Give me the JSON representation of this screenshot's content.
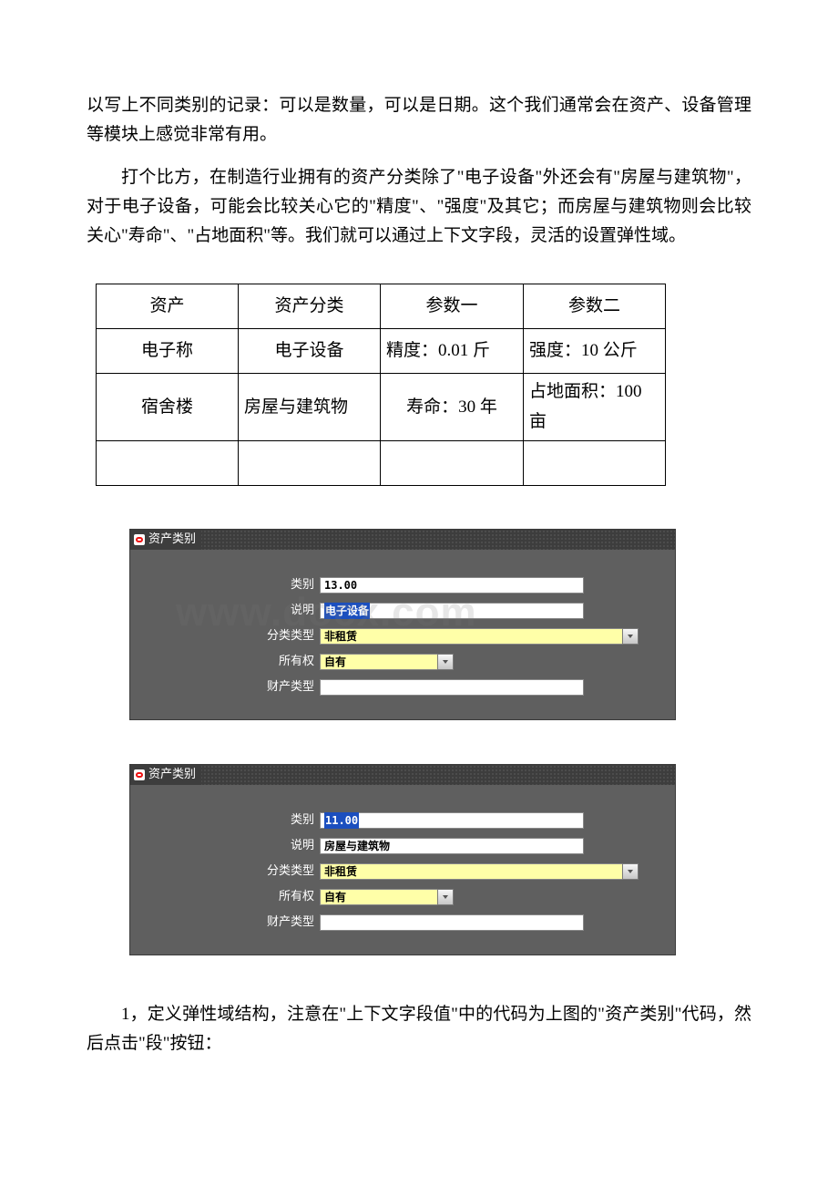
{
  "paragraphs": {
    "p1": "以写上不同类别的记录：可以是数量，可以是日期。这个我们通常会在资产、设备管理等模块上感觉非常有用。",
    "p2": "打个比方，在制造行业拥有的资产分类除了\"电子设备\"外还会有\"房屋与建筑物\"，对于电子设备，可能会比较关心它的\"精度\"、\"强度\"及其它；而房屋与建筑物则会比较关心\"寿命\"、\"占地面积\"等。我们就可以通过上下文字段，灵活的设置弹性域。",
    "p3": "1，定义弹性域结构，注意在\"上下文字段值\"中的代码为上图的\"资产类别\"代码，然后点击\"段\"按钮："
  },
  "table": {
    "headers": [
      "资产",
      "资产分类",
      "参数一",
      "参数二"
    ],
    "rows": [
      {
        "c1": "电子称",
        "c2": "电子设备",
        "c3": "精度：0.01 斤",
        "c4": "强度：10 公斤"
      },
      {
        "c1": "宿舍楼",
        "c2": "房屋与建筑物",
        "c3": "寿命：30 年",
        "c4": "占地面积：100 亩"
      },
      {
        "c1": "",
        "c2": "",
        "c3": "",
        "c4": ""
      }
    ]
  },
  "forms": [
    {
      "title": "资产类别",
      "labels": {
        "cat": "类别",
        "desc": "说明",
        "classtype": "分类类型",
        "owner": "所有权",
        "proptype": "财产类型"
      },
      "values": {
        "cat": "13.00",
        "desc": "电子设备",
        "classtype": "非租赁",
        "owner": "自有",
        "proptype": ""
      },
      "highlight": "desc"
    },
    {
      "title": "资产类别",
      "labels": {
        "cat": "类别",
        "desc": "说明",
        "classtype": "分类类型",
        "owner": "所有权",
        "proptype": "财产类型"
      },
      "values": {
        "cat": "11.00",
        "desc": "房屋与建筑物",
        "classtype": "非租赁",
        "owner": "自有",
        "proptype": ""
      },
      "highlight": "cat"
    }
  ],
  "watermark": "www.docx.com"
}
